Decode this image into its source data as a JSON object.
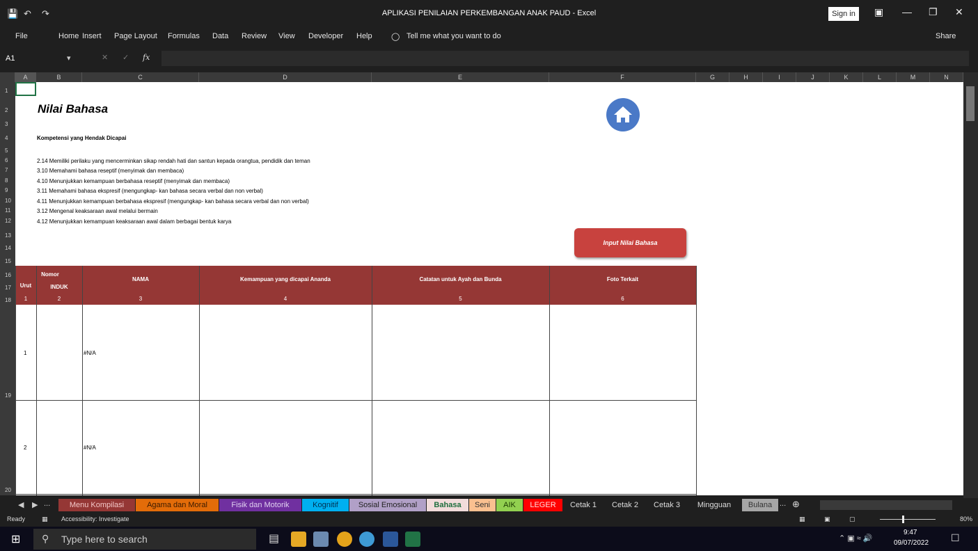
{
  "window": {
    "title": "APLIKASI PENILAIAN PERKEMBANGAN ANAK PAUD  -  Excel",
    "sign_in": "Sign in",
    "share": "Share"
  },
  "ribbon": {
    "tabs": [
      "File",
      "Home",
      "Insert",
      "Page Layout",
      "Formulas",
      "Data",
      "Review",
      "View",
      "Developer",
      "Help"
    ],
    "tell_me": "Tell me what you want to do"
  },
  "formula_bar": {
    "name_box": "A1",
    "fx": "fx",
    "value": ""
  },
  "columns": [
    "A",
    "B",
    "C",
    "D",
    "E",
    "F",
    "G",
    "H",
    "I",
    "J",
    "K",
    "L",
    "M",
    "N"
  ],
  "rows": [
    "1",
    "2",
    "3",
    "4",
    "5",
    "6",
    "7",
    "8",
    "9",
    "10",
    "11",
    "12",
    "13",
    "14",
    "15",
    "16",
    "17",
    "18",
    "19",
    "20"
  ],
  "sheet": {
    "title": "Nilai Bahasa",
    "subtitle": "Kompetensi yang Hendak Dicapai",
    "competencies": [
      "2.14 Memiliki perilaku yang mencerminkan sikap rendah hati dan santun kepada orangtua, pendidik dan teman",
      "3.10 Memahami bahasa reseptif (menyimak dan membaca)",
      "4.10 Menunjukkan kemampuan berbahasa reseptif (menyimak dan membaca)",
      "3.11 Memahami bahasa ekspresif (mengungkap- kan bahasa secara verbal dan non verbal)",
      "4.11 Menunjukkan kemampuan berbahasa ekspresif (mengungkap- kan bahasa secara verbal dan non verbal)",
      "3.12  Mengenal keaksaraan awal melalui bermain",
      "4.12 Menunjukkan kemampuan keaksaraan awal dalam berbagai bentuk karya"
    ],
    "input_button": "Input Nilai Bahasa",
    "table": {
      "nomor": "Nomor",
      "urut": "Urut",
      "induk": "INDUK",
      "nama": "NAMA",
      "kemampuan": "Kemampuan yang dicapai Ananda",
      "catatan": "Catatan untuk Ayah dan Bunda",
      "foto": "Foto Terkait",
      "numbers": [
        "1",
        "2",
        "3",
        "4",
        "5",
        "6"
      ],
      "rows": [
        {
          "urut": "1",
          "nama": "#N/A"
        },
        {
          "urut": "2",
          "nama": "#N/A"
        }
      ]
    }
  },
  "sheet_tabs": [
    {
      "label": "Menu Kompilasi",
      "bg": "#953735",
      "fg": "#f3c7c7"
    },
    {
      "label": "Agama dan Moral",
      "bg": "#e36c09",
      "fg": "#3a1a00"
    },
    {
      "label": "Fisik dan Motorik",
      "bg": "#7030a0",
      "fg": "#e0d0f0"
    },
    {
      "label": "Kognitif",
      "bg": "#00b0f0",
      "fg": "#003050"
    },
    {
      "label": "Sosial Emosional",
      "bg": "#b1a0c7",
      "fg": "#222222"
    },
    {
      "label": "Bahasa",
      "bg": "#f2dcdb",
      "fg": "#1e6e3e"
    },
    {
      "label": "Seni",
      "bg": "#fac090",
      "fg": "#333333"
    },
    {
      "label": "AIK",
      "bg": "#92d050",
      "fg": "#1a3a00"
    },
    {
      "label": "LEGER",
      "bg": "#ff0000",
      "fg": "#ffdede"
    },
    {
      "label": "Cetak 1",
      "bg": "#1f1f1f",
      "fg": "#dddddd"
    },
    {
      "label": "Cetak 2",
      "bg": "#1f1f1f",
      "fg": "#dddddd"
    },
    {
      "label": "Cetak 3",
      "bg": "#1f1f1f",
      "fg": "#dddddd"
    },
    {
      "label": "Mingguan",
      "bg": "#1f1f1f",
      "fg": "#dddddd"
    },
    {
      "label": "Bulana",
      "bg": "#a6a6a6",
      "fg": "#333333"
    }
  ],
  "status": {
    "ready": "Ready",
    "accessibility": "Accessibility: Investigate",
    "zoom": "80%"
  },
  "taskbar": {
    "search_placeholder": "Type here to search",
    "time": "9:47",
    "date": "09/07/2022"
  }
}
